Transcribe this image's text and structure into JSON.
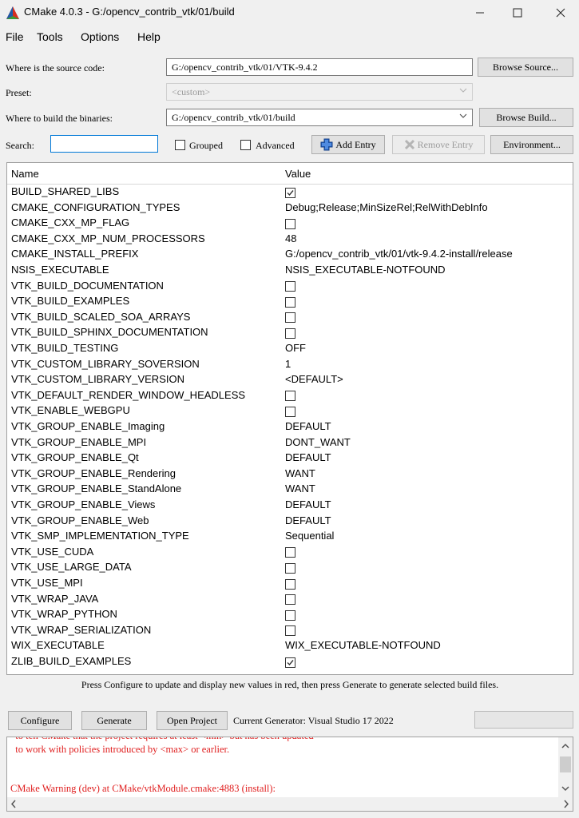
{
  "window": {
    "title": "CMake 4.0.3 - G:/opencv_contrib_vtk/01/build"
  },
  "menu": [
    "File",
    "Tools",
    "Options",
    "Help"
  ],
  "source": {
    "label": "Where is the source code:",
    "value": "G:/opencv_contrib_vtk/01/VTK-9.4.2",
    "button": "Browse Source..."
  },
  "preset": {
    "label": "Preset:",
    "value": "<custom>"
  },
  "build": {
    "label": "Where to build the binaries:",
    "value": "G:/opencv_contrib_vtk/01/build",
    "button": "Browse Build..."
  },
  "search": {
    "label": "Search:",
    "value": ""
  },
  "options": {
    "grouped": "Grouped",
    "advanced": "Advanced",
    "add_entry": "Add Entry",
    "remove_entry": "Remove Entry",
    "environment": "Environment..."
  },
  "table": {
    "headers": {
      "name": "Name",
      "value": "Value"
    },
    "rows": [
      {
        "name": "BUILD_SHARED_LIBS",
        "type": "bool",
        "checked": true
      },
      {
        "name": "CMAKE_CONFIGURATION_TYPES",
        "value": "Debug;Release;MinSizeRel;RelWithDebInfo"
      },
      {
        "name": "CMAKE_CXX_MP_FLAG",
        "type": "bool",
        "checked": false
      },
      {
        "name": "CMAKE_CXX_MP_NUM_PROCESSORS",
        "value": "48"
      },
      {
        "name": "CMAKE_INSTALL_PREFIX",
        "value": "G:/opencv_contrib_vtk/01/vtk-9.4.2-install/release"
      },
      {
        "name": "NSIS_EXECUTABLE",
        "value": "NSIS_EXECUTABLE-NOTFOUND"
      },
      {
        "name": "VTK_BUILD_DOCUMENTATION",
        "type": "bool",
        "checked": false
      },
      {
        "name": "VTK_BUILD_EXAMPLES",
        "type": "bool",
        "checked": false
      },
      {
        "name": "VTK_BUILD_SCALED_SOA_ARRAYS",
        "type": "bool",
        "checked": false
      },
      {
        "name": "VTK_BUILD_SPHINX_DOCUMENTATION",
        "type": "bool",
        "checked": false
      },
      {
        "name": "VTK_BUILD_TESTING",
        "value": "OFF"
      },
      {
        "name": "VTK_CUSTOM_LIBRARY_SOVERSION",
        "value": "1"
      },
      {
        "name": "VTK_CUSTOM_LIBRARY_VERSION",
        "value": "<DEFAULT>"
      },
      {
        "name": "VTK_DEFAULT_RENDER_WINDOW_HEADLESS",
        "type": "bool",
        "checked": false
      },
      {
        "name": "VTK_ENABLE_WEBGPU",
        "type": "bool",
        "checked": false
      },
      {
        "name": "VTK_GROUP_ENABLE_Imaging",
        "value": "DEFAULT"
      },
      {
        "name": "VTK_GROUP_ENABLE_MPI",
        "value": "DONT_WANT"
      },
      {
        "name": "VTK_GROUP_ENABLE_Qt",
        "value": "DEFAULT"
      },
      {
        "name": "VTK_GROUP_ENABLE_Rendering",
        "value": "WANT"
      },
      {
        "name": "VTK_GROUP_ENABLE_StandAlone",
        "value": "WANT"
      },
      {
        "name": "VTK_GROUP_ENABLE_Views",
        "value": "DEFAULT"
      },
      {
        "name": "VTK_GROUP_ENABLE_Web",
        "value": "DEFAULT"
      },
      {
        "name": "VTK_SMP_IMPLEMENTATION_TYPE",
        "value": "Sequential"
      },
      {
        "name": "VTK_USE_CUDA",
        "type": "bool",
        "checked": false
      },
      {
        "name": "VTK_USE_LARGE_DATA",
        "type": "bool",
        "checked": false
      },
      {
        "name": "VTK_USE_MPI",
        "type": "bool",
        "checked": false
      },
      {
        "name": "VTK_WRAP_JAVA",
        "type": "bool",
        "checked": false
      },
      {
        "name": "VTK_WRAP_PYTHON",
        "type": "bool",
        "checked": false
      },
      {
        "name": "VTK_WRAP_SERIALIZATION",
        "type": "bool",
        "checked": false
      },
      {
        "name": "WIX_EXECUTABLE",
        "value": "WIX_EXECUTABLE-NOTFOUND"
      },
      {
        "name": "ZLIB_BUILD_EXAMPLES",
        "type": "bool",
        "checked": true
      }
    ]
  },
  "hint": "Press Configure to update and display new values in red, then press Generate to generate selected build files.",
  "actions": {
    "configure": "Configure",
    "generate": "Generate",
    "open_project": "Open Project",
    "generator": "Current Generator: Visual Studio 17 2022"
  },
  "log": {
    "lines": [
      "  to tell CMake that the project requires at least <min> but has been updated",
      "  to work with policies introduced by <max> or earlier.",
      "",
      "",
      "CMake Warning (dev) at CMake/vtkModule.cmake:4883 (install):"
    ]
  },
  "colors": {
    "log_text": "#e02020",
    "title_icon": "#d62d20"
  }
}
